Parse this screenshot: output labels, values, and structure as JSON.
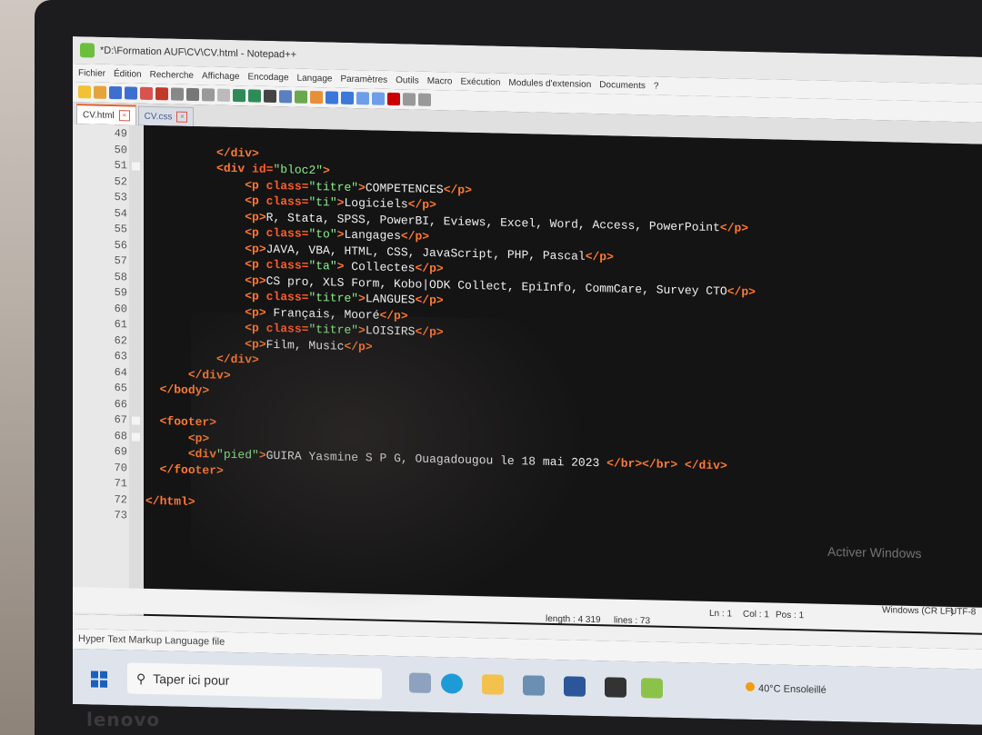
{
  "window": {
    "title": "*D:\\Formation AUF\\CV\\CV.html - Notepad++"
  },
  "menu": [
    "Fichier",
    "Édition",
    "Recherche",
    "Affichage",
    "Encodage",
    "Langage",
    "Paramètres",
    "Outils",
    "Macro",
    "Exécution",
    "Modules d'extension",
    "Documents",
    "?"
  ],
  "tabs": [
    {
      "label": "CV.html",
      "active": true
    },
    {
      "label": "CV.css",
      "active": false
    }
  ],
  "code_lines": [
    {
      "n": "49",
      "indent": "",
      "parts": []
    },
    {
      "n": "50",
      "indent": "          ",
      "parts": [
        [
          "t",
          "</div>"
        ]
      ]
    },
    {
      "n": "51",
      "indent": "          ",
      "parts": [
        [
          "t",
          "<div "
        ],
        [
          "a",
          "id="
        ],
        [
          "v",
          "\"bloc2\""
        ],
        [
          "t",
          ">"
        ]
      ]
    },
    {
      "n": "52",
      "indent": "              ",
      "parts": [
        [
          "t",
          "<p "
        ],
        [
          "a",
          "class="
        ],
        [
          "v",
          "\"titre\""
        ],
        [
          "t",
          ">"
        ],
        [
          "tx",
          "COMPETENCES"
        ],
        [
          "t",
          "</p>"
        ]
      ]
    },
    {
      "n": "53",
      "indent": "              ",
      "parts": [
        [
          "t",
          "<p "
        ],
        [
          "a",
          "class="
        ],
        [
          "v",
          "\"ti\""
        ],
        [
          "t",
          ">"
        ],
        [
          "tx",
          "Logiciels"
        ],
        [
          "t",
          "</p>"
        ]
      ]
    },
    {
      "n": "54",
      "indent": "              ",
      "parts": [
        [
          "t",
          "<p>"
        ],
        [
          "tx",
          "R, Stata, SPSS, PowerBI, Eviews, Excel, Word, Access, PowerPoint"
        ],
        [
          "t",
          "</p>"
        ]
      ]
    },
    {
      "n": "55",
      "indent": "              ",
      "parts": [
        [
          "t",
          "<p "
        ],
        [
          "a",
          "class="
        ],
        [
          "v",
          "\"to\""
        ],
        [
          "t",
          ">"
        ],
        [
          "tx",
          "Langages"
        ],
        [
          "t",
          "</p>"
        ]
      ]
    },
    {
      "n": "56",
      "indent": "              ",
      "parts": [
        [
          "t",
          "<p>"
        ],
        [
          "tx",
          "JAVA, VBA, HTML, CSS, JavaScript, PHP, Pascal"
        ],
        [
          "t",
          "</p>"
        ]
      ]
    },
    {
      "n": "57",
      "indent": "              ",
      "parts": [
        [
          "t",
          "<p "
        ],
        [
          "a",
          "class="
        ],
        [
          "v",
          "\"ta\""
        ],
        [
          "t",
          ">"
        ],
        [
          "tx",
          " Collectes"
        ],
        [
          "t",
          "</p>"
        ]
      ]
    },
    {
      "n": "58",
      "indent": "              ",
      "parts": [
        [
          "t",
          "<p>"
        ],
        [
          "tx",
          "CS pro, XLS Form, Kobo|ODK Collect, EpiInfo, CommCare, Survey CTO"
        ],
        [
          "t",
          "</p>"
        ]
      ]
    },
    {
      "n": "59",
      "indent": "              ",
      "parts": [
        [
          "t",
          "<p "
        ],
        [
          "a",
          "class="
        ],
        [
          "v",
          "\"titre\""
        ],
        [
          "t",
          ">"
        ],
        [
          "tx",
          "LANGUES"
        ],
        [
          "t",
          "</p>"
        ]
      ]
    },
    {
      "n": "60",
      "indent": "              ",
      "parts": [
        [
          "t",
          "<p>"
        ],
        [
          "tx",
          " Français, Mooré"
        ],
        [
          "t",
          "</p>"
        ]
      ]
    },
    {
      "n": "61",
      "indent": "              ",
      "parts": [
        [
          "t",
          "<p "
        ],
        [
          "a",
          "class="
        ],
        [
          "v",
          "\"titre\""
        ],
        [
          "t",
          ">"
        ],
        [
          "tx",
          "LOISIRS"
        ],
        [
          "t",
          "</p>"
        ]
      ]
    },
    {
      "n": "62",
      "indent": "              ",
      "parts": [
        [
          "t",
          "<p>"
        ],
        [
          "tx",
          "Film, Music"
        ],
        [
          "t",
          "</p>"
        ]
      ]
    },
    {
      "n": "63",
      "indent": "          ",
      "parts": [
        [
          "t",
          "</div>"
        ]
      ]
    },
    {
      "n": "64",
      "indent": "      ",
      "parts": [
        [
          "t",
          "</div>"
        ]
      ]
    },
    {
      "n": "65",
      "indent": "  ",
      "parts": [
        [
          "t",
          "</body>"
        ]
      ]
    },
    {
      "n": "66",
      "indent": "",
      "parts": []
    },
    {
      "n": "67",
      "indent": "  ",
      "parts": [
        [
          "t",
          "<footer>"
        ]
      ]
    },
    {
      "n": "68",
      "indent": "      ",
      "parts": [
        [
          "t",
          "<p>"
        ]
      ]
    },
    {
      "n": "69",
      "indent": "      ",
      "parts": [
        [
          "t",
          "<div"
        ],
        [
          "v",
          "\"pied\""
        ],
        [
          "t",
          ">"
        ],
        [
          "tx",
          "GUIRA Yasmine S P G, Ouagadougou le 18 mai 2023 "
        ],
        [
          "t",
          "</br></br> </div>"
        ]
      ]
    },
    {
      "n": "70",
      "indent": "  ",
      "parts": [
        [
          "t",
          "</footer>"
        ]
      ]
    },
    {
      "n": "71",
      "indent": "",
      "parts": []
    },
    {
      "n": "72",
      "indent": "",
      "parts": [
        [
          "t",
          "</html>"
        ]
      ]
    },
    {
      "n": "73",
      "indent": "",
      "parts": []
    }
  ],
  "marked_lines": [
    "51",
    "67",
    "68"
  ],
  "status": {
    "length": "length : 4 319",
    "lines": "lines : 73",
    "ln": "Ln : 1",
    "col": "Col : 1",
    "pos": "Pos : 1",
    "eol": "Windows (CR LF)",
    "encoding": "UTF-8"
  },
  "language_label": "Hyper Text Markup Language file",
  "watermark": "Activer Windows",
  "taskbar": {
    "search_placeholder": "Taper ici pour",
    "weather": "40°C  Ensoleillé"
  },
  "colors": {
    "tag": "#ff7a33",
    "attr_value": "#8cf08a",
    "text": "#f0f0f0",
    "editor_bg": "#141414"
  }
}
